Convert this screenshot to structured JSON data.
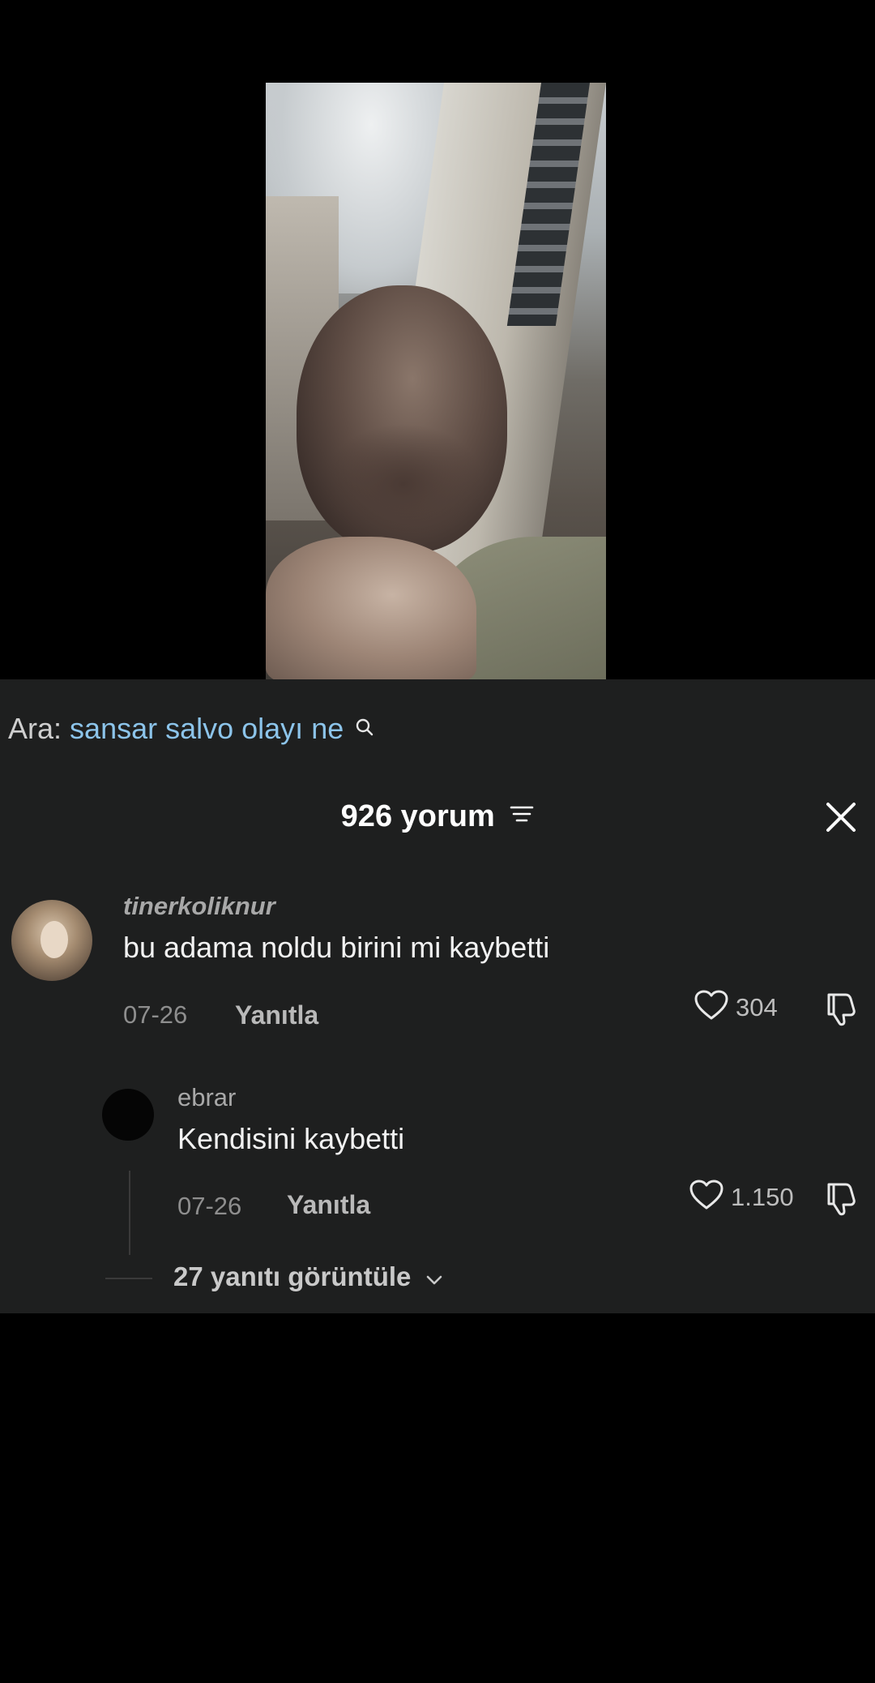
{
  "search": {
    "prefix": "Ara:",
    "query": "sansar salvo olayı ne"
  },
  "comments_header": {
    "title": "926 yorum"
  },
  "comments": [
    {
      "username": "tinerkoliknur",
      "text": "bu adama noldu birini mi kaybetti",
      "date": "07-26",
      "reply_label": "Yanıtla",
      "likes": "304"
    }
  ],
  "replies": [
    {
      "username": "ebrar",
      "text": "Kendisini kaybetti",
      "date": "07-26",
      "reply_label": "Yanıtla",
      "likes": "1.150"
    }
  ],
  "view_replies": {
    "label": "27 yanıtı görüntüle"
  },
  "colors": {
    "panel_bg": "#1e1f1f",
    "search_accent": "#8cc4ea",
    "page_bg": "#000000"
  },
  "icons": [
    "search-icon",
    "filter-icon",
    "close-icon",
    "heart-icon",
    "dislike-icon",
    "chevron-down-icon"
  ]
}
